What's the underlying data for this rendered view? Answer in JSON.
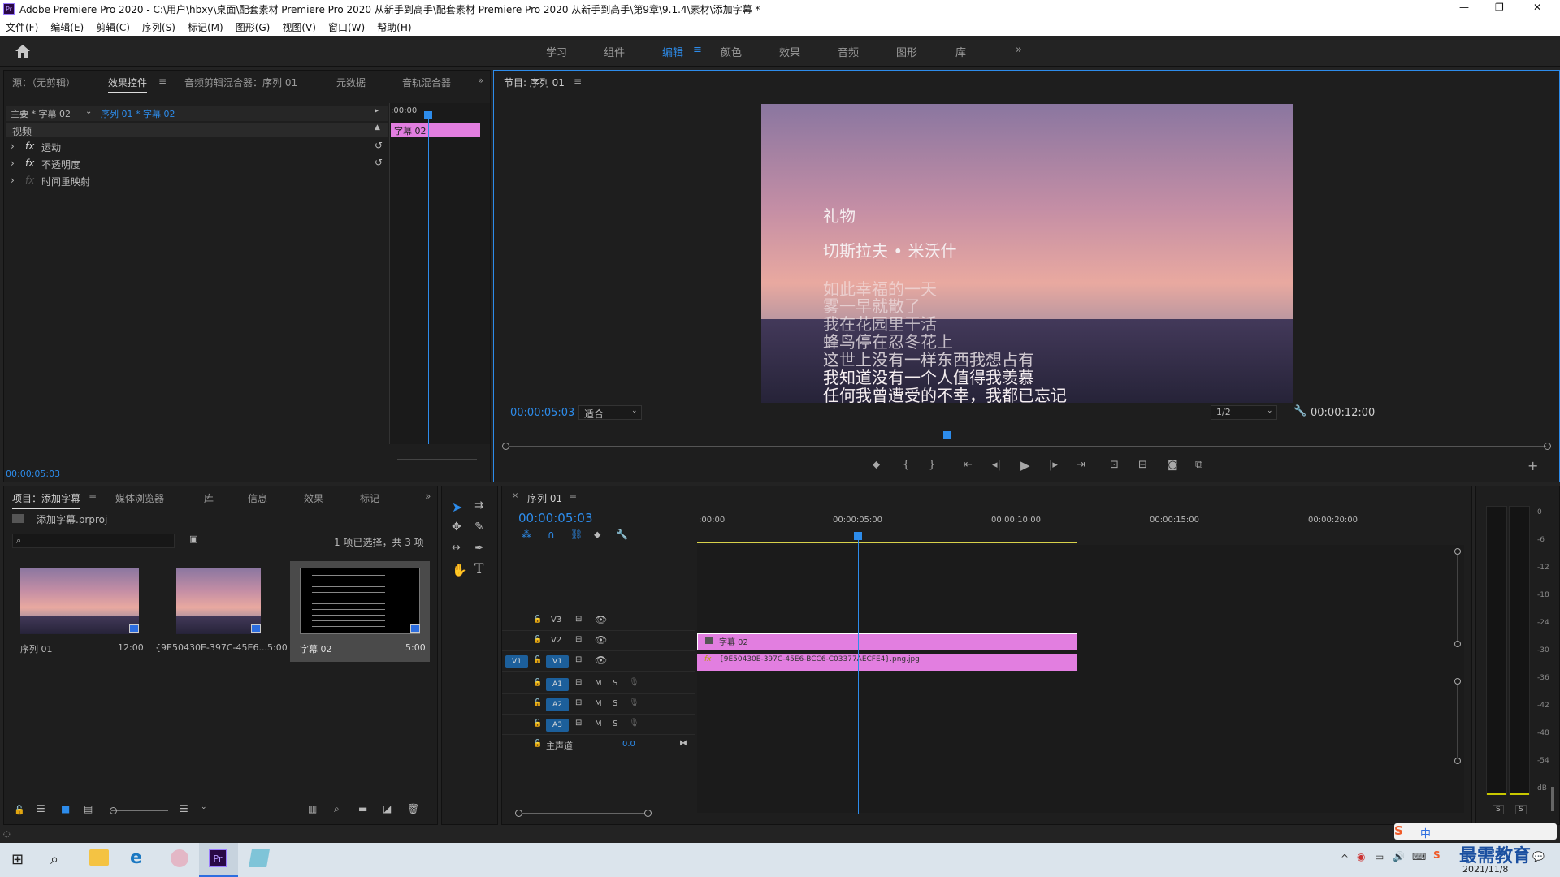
{
  "window": {
    "title": "Adobe Premiere Pro 2020 - C:\\用户\\hbxy\\桌面\\配套素材 Premiere Pro 2020 从新手到高手\\配套素材 Premiere Pro 2020 从新手到高手\\第9章\\9.1.4\\素材\\添加字幕 *",
    "minimize": "—",
    "maximize": "❐",
    "close": "✕"
  },
  "menu": [
    "文件(F)",
    "编辑(E)",
    "剪辑(C)",
    "序列(S)",
    "标记(M)",
    "图形(G)",
    "视图(V)",
    "窗口(W)",
    "帮助(H)"
  ],
  "workspaces": {
    "items": [
      "学习",
      "组件",
      "编辑",
      "颜色",
      "效果",
      "音频",
      "图形",
      "库"
    ],
    "active": "编辑",
    "more": "»"
  },
  "effect_panel": {
    "tabs": [
      "源：（无剪辑）",
      "效果控件",
      "音频剪辑混合器：序列 01",
      "元数据",
      "音轨混合器"
    ],
    "source_label": "主要 * 字幕 02",
    "seq_label": "序列 01 * 字幕 02",
    "timecode_start": ":00:00",
    "video_label": "视频",
    "clip_name": "字幕 02",
    "effects": [
      "运动",
      "不透明度",
      "时间重映射"
    ],
    "fx": "fx",
    "timecode": "00:00:05:03"
  },
  "program": {
    "title": "节目: 序列 01",
    "timecode": "00:00:05:03",
    "fit": "适合",
    "resolution": "1/2",
    "duration": "00:00:12:00",
    "poem": {
      "title": "礼物",
      "author": "切斯拉夫 • 米沃什",
      "lines": [
        "如此幸福的一天",
        "雾一早就散了",
        "我在花园里干活",
        "蜂鸟停在忍冬花上",
        "这世上没有一样东西我想占有",
        "我知道没有一个人值得我羡慕",
        "任何我曾遭受的不幸，我都已忘记"
      ]
    }
  },
  "project": {
    "tabs": [
      "项目：添加字幕",
      "媒体浏览器",
      "库",
      "信息",
      "效果",
      "标记"
    ],
    "file": "添加字幕.prproj",
    "status": "1 项已选择，共 3 项",
    "search_placeholder": "",
    "items": [
      {
        "name": "序列 01",
        "duration": "12:00"
      },
      {
        "name": "{9E50430E-397C-45E6...",
        "duration": "5:00"
      },
      {
        "name": "字幕 02",
        "duration": "5:00"
      }
    ]
  },
  "timeline": {
    "title": "序列 01",
    "timecode": "00:00:05:03",
    "ruler": [
      ":00:00",
      "00:00:05:00",
      "00:00:10:00",
      "00:00:15:00",
      "00:00:20:00"
    ],
    "tracks": {
      "video": [
        "V3",
        "V2",
        "V1"
      ],
      "audio": [
        "A1",
        "A2",
        "A3"
      ]
    },
    "src_v1": "V1",
    "master": "主声道",
    "master_val": "0.0",
    "clips": {
      "v2": "字幕 02",
      "v1": "{9E50430E-397C-45E6-BCC6-C03377AECFE4}.png.jpg"
    },
    "m": "M",
    "s": "S"
  },
  "meter": {
    "labels": [
      "0",
      "-6",
      "-12",
      "-18",
      "-24",
      "-30",
      "-36",
      "-42",
      "-48",
      "-54",
      "dB"
    ],
    "solo": [
      "S",
      "S"
    ]
  },
  "taskbar": {
    "date": "2021/11/8",
    "watermark": "最需教育",
    "ime": "中"
  }
}
